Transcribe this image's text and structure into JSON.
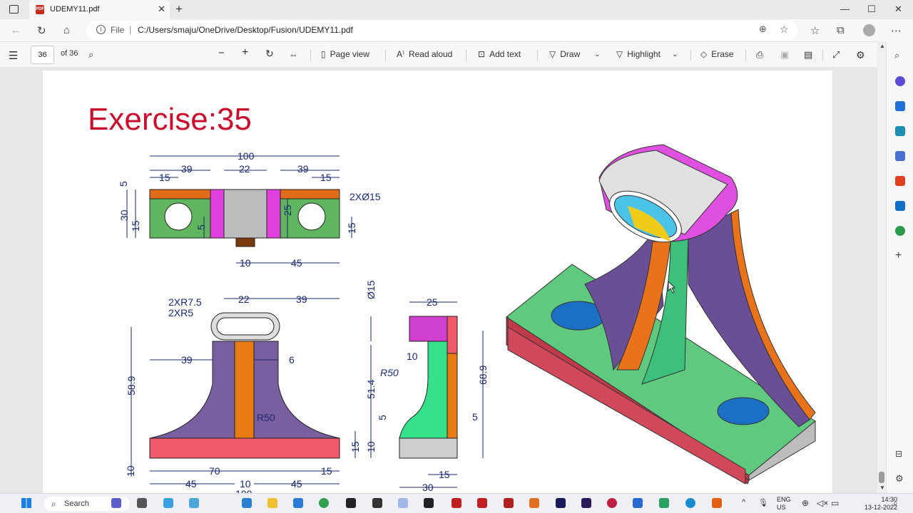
{
  "tab": {
    "title": "UDEMY11.pdf"
  },
  "address": {
    "scheme": "File",
    "url": "C:/Users/smaju/OneDrive/Desktop/Fusion/UDEMY11.pdf"
  },
  "toolbar": {
    "page_current": "36",
    "page_total": "of 36",
    "page_view": "Page view",
    "read_aloud": "Read aloud",
    "add_text": "Add text",
    "draw": "Draw",
    "highlight": "Highlight",
    "erase": "Erase"
  },
  "document": {
    "title": "Exercise:35",
    "top_view_dims": [
      "100",
      "39",
      "22",
      "39",
      "15",
      "15",
      "5",
      "30",
      "15",
      "25",
      "5",
      "15",
      "10",
      "45",
      "2XØ15"
    ],
    "front_view_dims": [
      "2XR7.5",
      "2XR5",
      "22",
      "39",
      "39",
      "6",
      "58.9",
      "R50",
      "70",
      "10",
      "45",
      "10",
      "45",
      "15",
      "100",
      "15",
      "10"
    ],
    "side_view_dims": [
      "Ø15",
      "25",
      "10",
      "R50",
      "51.4",
      "68.9",
      "5",
      "5",
      "10",
      "15",
      "30"
    ]
  },
  "taskbar": {
    "search": "Search",
    "lang": "ENG",
    "lang2": "US",
    "time": "14:30",
    "date": "13-12-2022"
  }
}
